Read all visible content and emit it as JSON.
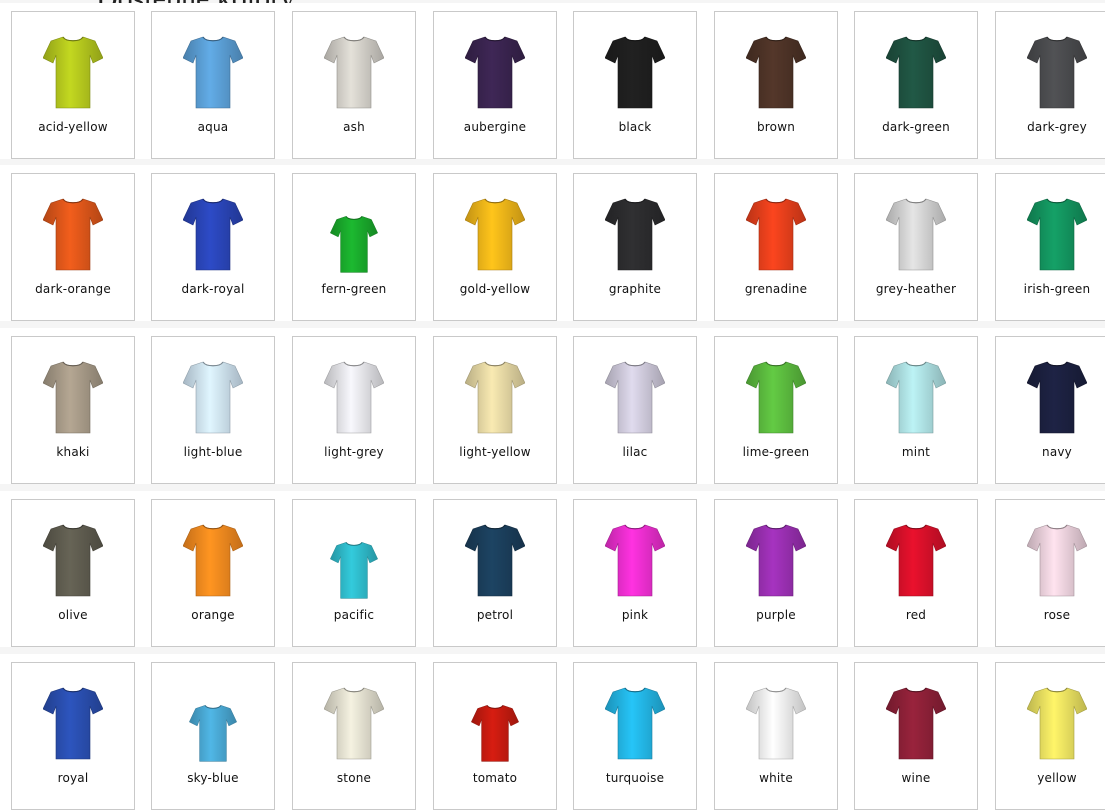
{
  "page": {
    "title": "Dostępne kolory:"
  },
  "colors": [
    {
      "name": "acid-yellow",
      "hex": "#b5c81e"
    },
    {
      "name": "aqua",
      "hex": "#5b9fd6"
    },
    {
      "name": "ash",
      "hex": "#d3d0c9"
    },
    {
      "name": "aubergine",
      "hex": "#3a2450"
    },
    {
      "name": "black",
      "hex": "#1f1f1f"
    },
    {
      "name": "brown",
      "hex": "#4e3327"
    },
    {
      "name": "dark-green",
      "hex": "#1f5241"
    },
    {
      "name": "dark-grey",
      "hex": "#4b4c4f"
    },
    {
      "name": "dark-orange",
      "hex": "#e0571a"
    },
    {
      "name": "dark-royal",
      "hex": "#2a45b8"
    },
    {
      "name": "fern-green",
      "hex": "#1aab2c"
    },
    {
      "name": "gold-yellow",
      "hex": "#f2b619"
    },
    {
      "name": "graphite",
      "hex": "#2c2c2e"
    },
    {
      "name": "grenadine",
      "hex": "#e8401c"
    },
    {
      "name": "grey-heather",
      "hex": "#d4d4d4"
    },
    {
      "name": "irish-green",
      "hex": "#13955f"
    },
    {
      "name": "khaki",
      "hex": "#a89b88"
    },
    {
      "name": "light-blue",
      "hex": "#cfe4f4"
    },
    {
      "name": "light-grey",
      "hex": "#e6e6ea"
    },
    {
      "name": "light-yellow",
      "hex": "#e7d9a5"
    },
    {
      "name": "lilac",
      "hex": "#cfcbdc"
    },
    {
      "name": "lime-green",
      "hex": "#5cbc3f"
    },
    {
      "name": "mint",
      "hex": "#aee1e3"
    },
    {
      "name": "navy",
      "hex": "#1c2040"
    },
    {
      "name": "olive",
      "hex": "#5f5d50"
    },
    {
      "name": "orange",
      "hex": "#f58a1f"
    },
    {
      "name": "pacific",
      "hex": "#2fbccc"
    },
    {
      "name": "petrol",
      "hex": "#1b3f5c"
    },
    {
      "name": "pink",
      "hex": "#ec2ed0"
    },
    {
      "name": "purple",
      "hex": "#9a2fb2"
    },
    {
      "name": "red",
      "hex": "#d9102a"
    },
    {
      "name": "rose",
      "hex": "#ecd2dd"
    },
    {
      "name": "royal",
      "hex": "#2a4fb0"
    },
    {
      "name": "sky-blue",
      "hex": "#4aa9d5"
    },
    {
      "name": "stone",
      "hex": "#e3e0d0"
    },
    {
      "name": "tomato",
      "hex": "#c71b10"
    },
    {
      "name": "turquoise",
      "hex": "#23b6e6"
    },
    {
      "name": "white",
      "hex": "#f2f2f2"
    },
    {
      "name": "wine",
      "hex": "#8e2038"
    },
    {
      "name": "yellow",
      "hex": "#ece361"
    }
  ]
}
